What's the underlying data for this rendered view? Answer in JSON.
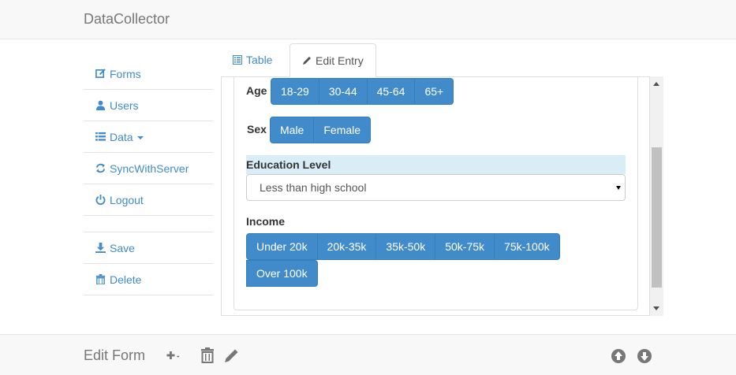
{
  "app": {
    "brand": "DataCollector"
  },
  "sidebar": {
    "items": [
      {
        "label": "Forms",
        "icon": "edit-icon"
      },
      {
        "label": "Users",
        "icon": "user-icon"
      },
      {
        "label": "Data",
        "icon": "list-icon",
        "has_caret": true
      },
      {
        "label": "SyncWithServer",
        "icon": "refresh-icon"
      },
      {
        "label": "Logout",
        "icon": "power-icon"
      }
    ],
    "actions": [
      {
        "label": "Save",
        "icon": "download-icon"
      },
      {
        "label": "Delete",
        "icon": "trash-icon"
      }
    ]
  },
  "tabs": [
    {
      "label": "Table",
      "icon": "list-alt-icon",
      "active": false
    },
    {
      "label": "Edit Entry",
      "icon": "pencil-icon",
      "active": true
    }
  ],
  "form": {
    "age": {
      "label": "Age",
      "options": [
        "18-29",
        "30-44",
        "45-64",
        "65+"
      ]
    },
    "sex": {
      "label": "Sex",
      "options": [
        "Male",
        "Female"
      ]
    },
    "education": {
      "label": "Education Level",
      "selected": "Less than high school"
    },
    "income": {
      "label": "Income",
      "options": [
        "Under 20k",
        "20k-35k",
        "35k-50k",
        "50k-75k",
        "75k-100k"
      ],
      "options_row2": [
        "Over 100k"
      ]
    }
  },
  "footer": {
    "title": "Edit Form"
  },
  "colors": {
    "primary": "#428bca",
    "link": "#428bca",
    "highlight": "#d9edf7"
  }
}
